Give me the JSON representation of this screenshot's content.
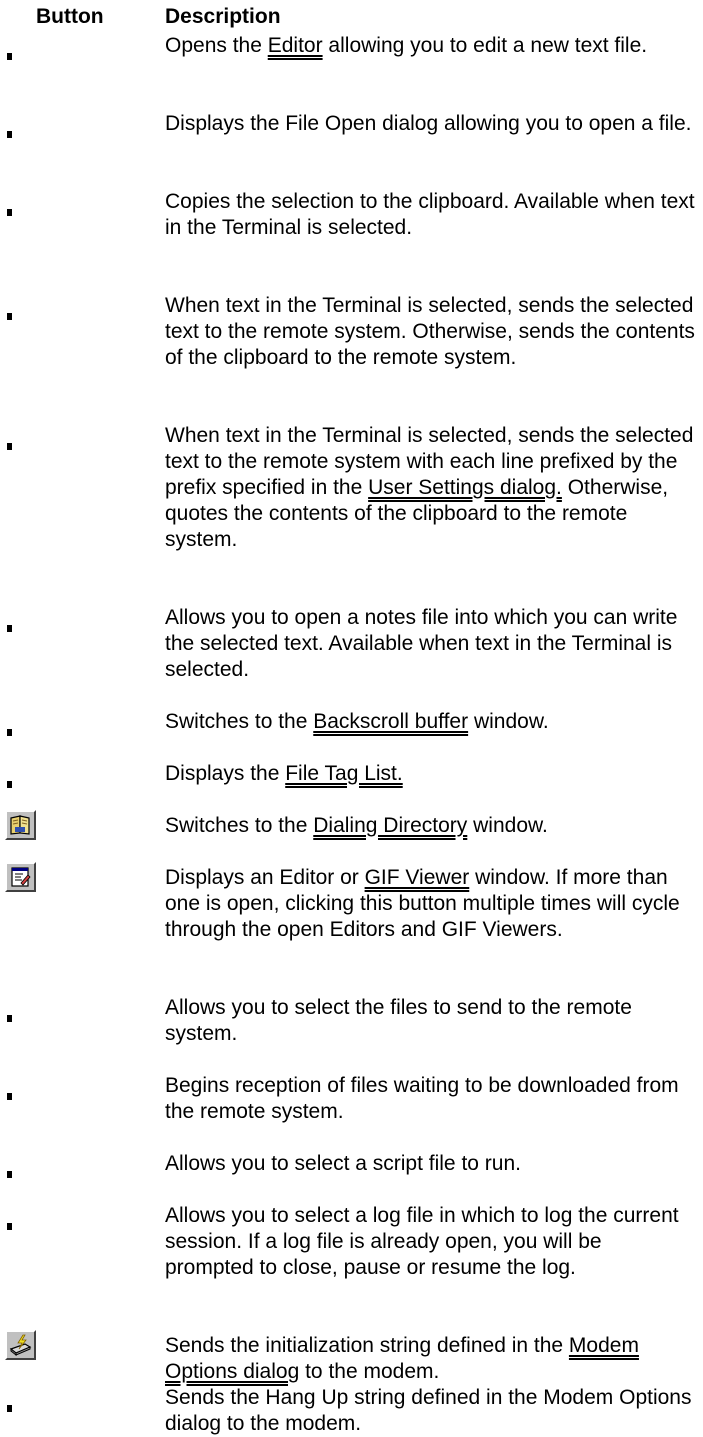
{
  "header": {
    "button": "Button",
    "description": "Description"
  },
  "rows": [
    {
      "icon": "bullet",
      "parts": [
        {
          "t": "Opens the "
        },
        {
          "t": "Editor",
          "link": true
        },
        {
          "t": " allowing you to edit a new text file."
        }
      ]
    },
    {
      "icon": "bullet",
      "parts": [
        {
          "t": "Displays the File Open dialog allowing you to open a file."
        }
      ]
    },
    {
      "icon": "bullet",
      "parts": [
        {
          "t": "Copies the selection to the clipboard. Available when text in the Terminal is selected."
        }
      ]
    },
    {
      "icon": "bullet",
      "parts": [
        {
          "t": "When text in the Terminal is selected, sends the selected text to the remote system. Otherwise, sends the contents of the clipboard to the remote system."
        }
      ]
    },
    {
      "icon": "bullet",
      "parts": [
        {
          "t": "When text in the Terminal is selected, sends the selected text to the remote system with each line prefixed by the prefix specified in the "
        },
        {
          "t": "User Settings dialog.",
          "link": true
        },
        {
          "t": " Otherwise, quotes the contents of the clipboard to the remote system."
        }
      ]
    },
    {
      "icon": "bullet",
      "parts": [
        {
          "t": "Allows you to open a notes file into which you can write the selected text. Available when text in the Terminal is selected."
        }
      ]
    },
    {
      "icon": "bullet",
      "parts": [
        {
          "t": "Switches to the "
        },
        {
          "t": "Backscroll buffer",
          "link": true
        },
        {
          "t": " window."
        }
      ]
    },
    {
      "icon": "bullet",
      "parts": [
        {
          "t": "Displays the "
        },
        {
          "t": "File Tag List.",
          "link": true
        }
      ]
    },
    {
      "icon": "dialing-directory-icon",
      "parts": [
        {
          "t": "Switches to the "
        },
        {
          "t": "Dialing Directory",
          "link": true
        },
        {
          "t": " window."
        }
      ]
    },
    {
      "icon": "editor-window-icon",
      "parts": [
        {
          "t": "Displays an Editor or "
        },
        {
          "t": "GIF Viewer",
          "link": true
        },
        {
          "t": " window. If more than one is open, clicking this button multiple times will cycle through the open Editors and GIF Viewers."
        }
      ]
    },
    {
      "icon": "bullet",
      "parts": [
        {
          "t": "Allows you to select the files to send to the remote system."
        }
      ]
    },
    {
      "icon": "bullet",
      "parts": [
        {
          "t": "Begins reception of files waiting to be downloaded from the remote system."
        }
      ]
    },
    {
      "icon": "bullet",
      "parts": [
        {
          "t": "Allows you to select a script file to run."
        }
      ]
    },
    {
      "icon": "bullet",
      "parts": [
        {
          "t": "Allows you to select a log file in which to log the current session. If a log file is already open, you will be prompted to close, pause or resume the log."
        }
      ]
    },
    {
      "icon": "modem-init-icon",
      "parts": [
        {
          "t": "Sends the initialization string defined in the "
        },
        {
          "t": "Modem Options dialog",
          "link": true
        },
        {
          "t": " to the modem."
        }
      ]
    },
    {
      "icon": "bullet",
      "parts": [
        {
          "t": "Sends the Hang Up string defined in the Modem Options dialog to the modem."
        }
      ]
    }
  ]
}
